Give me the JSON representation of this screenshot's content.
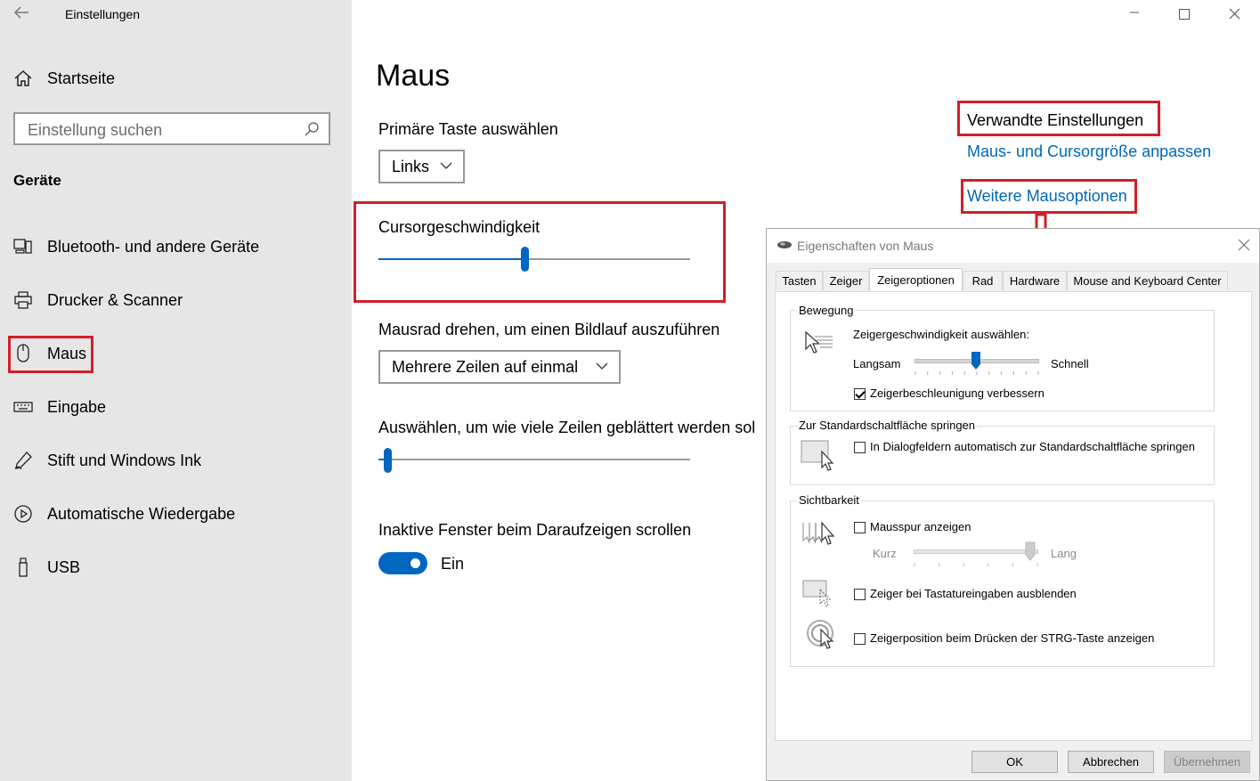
{
  "window": {
    "title": "Einstellungen",
    "back_icon": "back-arrow-icon",
    "controls": {
      "minimize": "—",
      "maximize": "☐",
      "close": "✕"
    }
  },
  "sidebar": {
    "home_label": "Startseite",
    "search_placeholder": "Einstellung suchen",
    "group_title": "Geräte",
    "items": [
      {
        "label": "Bluetooth- und andere Geräte",
        "icon": "bluetooth-devices-icon"
      },
      {
        "label": "Drucker & Scanner",
        "icon": "printer-icon"
      },
      {
        "label": "Maus",
        "icon": "mouse-icon",
        "selected": true
      },
      {
        "label": "Eingabe",
        "icon": "keyboard-icon"
      },
      {
        "label": "Stift und Windows Ink",
        "icon": "pen-icon"
      },
      {
        "label": "Automatische Wiedergabe",
        "icon": "autoplay-icon"
      },
      {
        "label": "USB",
        "icon": "usb-icon"
      }
    ]
  },
  "main": {
    "title": "Maus",
    "primary_button": {
      "label": "Primäre Taste auswählen",
      "value": "Links"
    },
    "cursor_speed": {
      "label": "Cursorgeschwindigkeit",
      "value_fraction": 0.47
    },
    "wheel": {
      "label": "Mausrad drehen, um einen Bildlauf auszuführen",
      "value": "Mehrere Zeilen auf einmal"
    },
    "lines": {
      "label": "Auswählen, um wie viele Zeilen geblättert werden sol",
      "value_fraction": 0.03
    },
    "inactive_scroll": {
      "label": "Inaktive Fenster beim Daraufzeigen scrollen",
      "state": "Ein"
    }
  },
  "related": {
    "title": "Verwandte Einstellungen",
    "link1": "Maus- und Cursorgröße anpassen",
    "link2": "Weitere Mausoptionen"
  },
  "dialog": {
    "title": "Eigenschaften von Maus",
    "tabs": [
      "Tasten",
      "Zeiger",
      "Zeigeroptionen",
      "Rad",
      "Hardware",
      "Mouse and Keyboard Center"
    ],
    "active_tab": "Zeigeroptionen",
    "bewegung": {
      "title": "Bewegung",
      "speed_label": "Zeigergeschwindigkeit auswählen:",
      "slow": "Langsam",
      "fast": "Schnell",
      "speed_fraction": 0.5,
      "acceleration": "Zeigerbeschleunigung verbessern",
      "acceleration_checked": true
    },
    "snap": {
      "title": "Zur Standardschaltfläche springen",
      "option": "In Dialogfeldern automatisch zur Standardschaltfläche springen",
      "checked": false
    },
    "visibility": {
      "title": "Sichtbarkeit",
      "trails": "Mausspur anzeigen",
      "short": "Kurz",
      "long": "Lang",
      "trail_fraction": 0.95,
      "hide": "Zeiger bei Tastatureingaben ausblenden",
      "ctrl": "Zeigerposition beim Drücken der STRG-Taste anzeigen"
    },
    "buttons": {
      "ok": "OK",
      "cancel": "Abbrechen",
      "apply": "Übernehmen"
    }
  },
  "colors": {
    "accent": "#0067c0",
    "highlight_border": "#d11f2a",
    "link": "#0067b8"
  }
}
